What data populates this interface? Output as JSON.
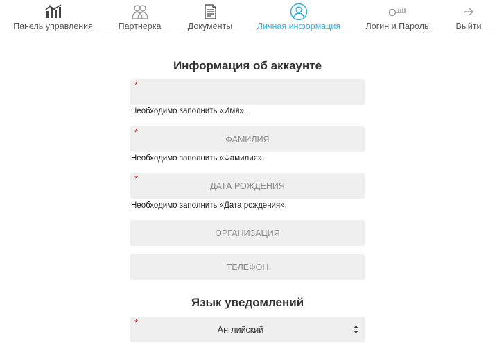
{
  "nav": {
    "items": [
      {
        "label": "Панель управления",
        "icon": "chart-bars-icon"
      },
      {
        "label": "Партнерка",
        "icon": "users-icon"
      },
      {
        "label": "Документы",
        "icon": "document-icon"
      },
      {
        "label": "Личная информация",
        "icon": "user-circle-icon",
        "active": true
      },
      {
        "label": "Логин и Пароль",
        "icon": "key-icon"
      },
      {
        "label": "Выйти",
        "icon": "arrow-right-icon"
      }
    ],
    "active_color": "#35b3e0"
  },
  "account": {
    "title": "Информация об аккаунте",
    "first_name": {
      "value": "",
      "placeholder": "",
      "required_mark": "*",
      "error": "Необходимо заполнить «Имя»."
    },
    "last_name": {
      "value": "",
      "placeholder": "ФАМИЛИЯ",
      "required_mark": "*",
      "error": "Необходимо заполнить «Фамилия»."
    },
    "birth_date": {
      "value": "",
      "placeholder": "ДАТА РОЖДЕНИЯ",
      "required_mark": "*",
      "error": "Необходимо заполнить «Дата рождения»."
    },
    "organization": {
      "value": "",
      "placeholder": "ОРГАНИЗАЦИЯ"
    },
    "phone": {
      "value": "",
      "placeholder": "ТЕЛЕФОН"
    }
  },
  "notifications": {
    "title": "Язык уведомлений",
    "language": {
      "selected": "Английский",
      "required_mark": "*"
    }
  },
  "colors": {
    "required": "#e0231c",
    "field_bg": "#efefef"
  }
}
